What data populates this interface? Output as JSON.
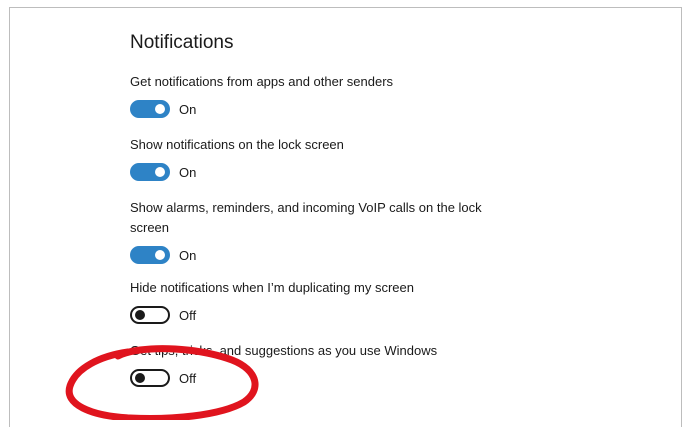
{
  "page": {
    "title": "Notifications"
  },
  "settings": [
    {
      "label": "Get notifications from apps and other senders",
      "state": "On"
    },
    {
      "label": "Show notifications on the lock screen",
      "state": "On"
    },
    {
      "label": "Show alarms, reminders, and incoming VoIP calls on the lock screen",
      "state": "On"
    },
    {
      "label": "Hide notifications when I’m duplicating my screen",
      "state": "Off"
    },
    {
      "label": "Get tips, tricks, and suggestions as you use Windows",
      "state": "Off"
    }
  ],
  "colors": {
    "accent": "#2e83c6",
    "annotation": "#e0141e"
  }
}
